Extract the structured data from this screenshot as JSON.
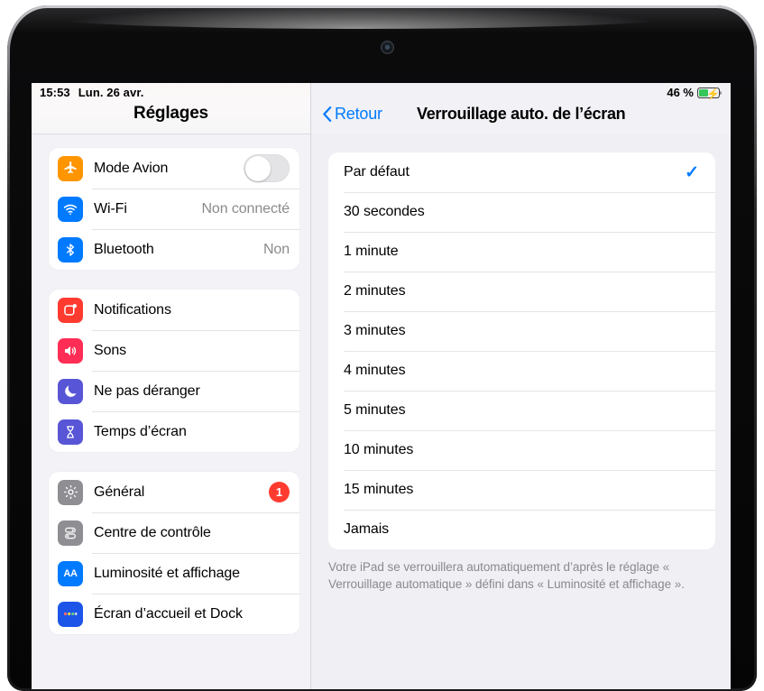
{
  "status_bar": {
    "time": "15:53",
    "date": "Lun. 26 avr.",
    "battery_percent": "46 %"
  },
  "sidebar": {
    "title": "Réglages",
    "groups": [
      {
        "rows": [
          {
            "label": "Mode Avion",
            "icon": "airplane-icon",
            "color": "#ff9500",
            "control": "toggle",
            "toggle_on": false
          },
          {
            "label": "Wi-Fi",
            "icon": "wifi-icon",
            "color": "#007aff",
            "control": "value",
            "value": "Non connecté"
          },
          {
            "label": "Bluetooth",
            "icon": "bluetooth-icon",
            "color": "#007aff",
            "control": "value",
            "value": "Non"
          }
        ]
      },
      {
        "rows": [
          {
            "label": "Notifications",
            "icon": "notifications-icon",
            "color": "#ff3b30",
            "control": "none"
          },
          {
            "label": "Sons",
            "icon": "speaker-icon",
            "color": "#ff2d55",
            "control": "none"
          },
          {
            "label": "Ne pas déranger",
            "icon": "moon-icon",
            "color": "#5856d6",
            "control": "none"
          },
          {
            "label": "Temps d’écran",
            "icon": "hourglass-icon",
            "color": "#5856d6",
            "control": "none"
          }
        ]
      },
      {
        "rows": [
          {
            "label": "Général",
            "icon": "gear-icon",
            "color": "#8e8e93",
            "control": "badge",
            "badge": "1"
          },
          {
            "label": "Centre de contrôle",
            "icon": "control-center-icon",
            "color": "#8e8e93",
            "control": "none"
          },
          {
            "label": "Luminosité et affichage",
            "icon": "display-aa-icon",
            "color": "#007aff",
            "control": "none"
          },
          {
            "label": "Écran d’accueil et Dock",
            "icon": "home-screen-icon",
            "color": "#1c55e8",
            "control": "none"
          }
        ]
      }
    ]
  },
  "detail": {
    "back_label": "Retour",
    "title": "Verrouillage auto. de l’écran",
    "options": [
      {
        "label": "Par défaut",
        "selected": true
      },
      {
        "label": "30 secondes",
        "selected": false
      },
      {
        "label": "1 minute",
        "selected": false
      },
      {
        "label": "2 minutes",
        "selected": false
      },
      {
        "label": "3 minutes",
        "selected": false
      },
      {
        "label": "4 minutes",
        "selected": false
      },
      {
        "label": "5 minutes",
        "selected": false
      },
      {
        "label": "10 minutes",
        "selected": false
      },
      {
        "label": "15 minutes",
        "selected": false
      },
      {
        "label": "Jamais",
        "selected": false
      }
    ],
    "footnote": "Votre iPad se verrouillera automatiquement d’après le réglage « Verrouillage automatique » défini dans « Luminosité et affichage »."
  },
  "colors": {
    "accent": "#007aff",
    "badge": "#ff3b30",
    "battery_fill": "#34c759"
  }
}
